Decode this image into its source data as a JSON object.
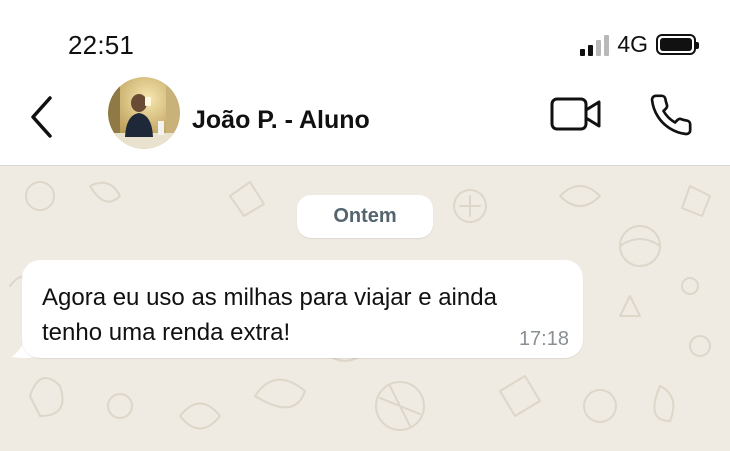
{
  "status_bar": {
    "time": "22:51",
    "network": "4G",
    "signal_icon": "cellular-signal-icon",
    "battery_icon": "battery-icon"
  },
  "header": {
    "contact_name": "João P. - Aluno",
    "back_icon": "chevron-left-icon",
    "video_icon": "video-camera-icon",
    "call_icon": "phone-icon"
  },
  "chat": {
    "date_label": "Ontem",
    "messages": [
      {
        "text": "Agora eu uso as milhas para viajar e ainda tenho uma renda extra!",
        "time": "17:18"
      }
    ]
  },
  "colors": {
    "chat_background": "#efeae2",
    "bubble": "#ffffff",
    "date_pill_text": "#54656f",
    "timestamp": "#8a8f93"
  }
}
